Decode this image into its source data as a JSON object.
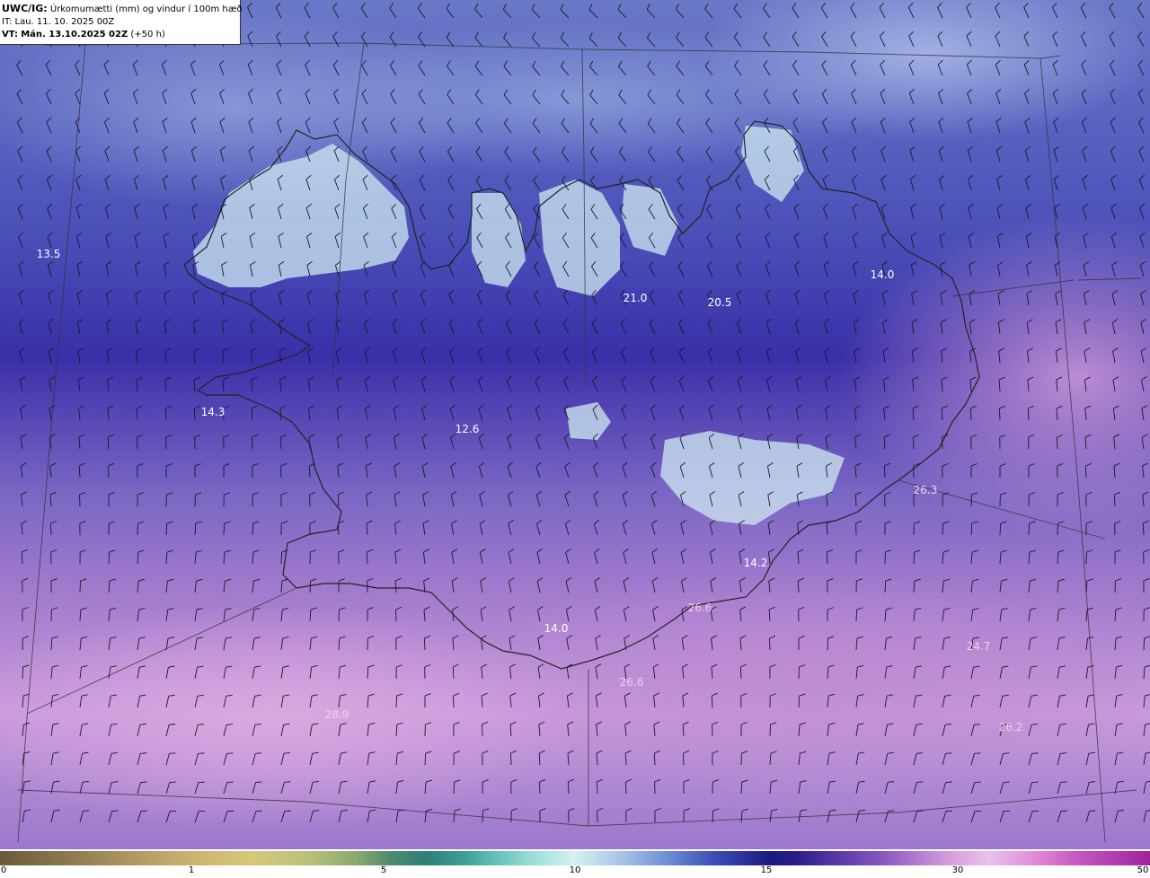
{
  "header": {
    "code": "UWC/IG:",
    "subtitle": "Úrkomumætti (mm) og vindur í 100m hæð",
    "it_line": "IT: Lau. 11. 10. 2025 00Z",
    "vt_label": "VT:",
    "vt_value": "Mán. 13.10.2025 02Z",
    "vt_suffix": "(+50 h)"
  },
  "map": {
    "labels": [
      {
        "id": "nw-sea",
        "text": "13.5"
      },
      {
        "id": "west",
        "text": "14.3"
      },
      {
        "id": "central-w",
        "text": "12.6"
      },
      {
        "id": "north",
        "text": "21.0"
      },
      {
        "id": "north-e",
        "text": "20.5"
      },
      {
        "id": "east",
        "text": "14.0"
      },
      {
        "id": "se-land",
        "text": "14.2"
      },
      {
        "id": "south",
        "text": "14.0"
      },
      {
        "id": "east-sea",
        "text": "26.3"
      },
      {
        "id": "se-coast",
        "text": "26.6"
      },
      {
        "id": "se-sea",
        "text": "24.7"
      },
      {
        "id": "s-sea",
        "text": "26.6"
      },
      {
        "id": "sw-sea",
        "text": "28.9"
      },
      {
        "id": "sse-sea",
        "text": "26.2"
      }
    ],
    "colors": {
      "precip_low": "#d4f1f0",
      "precip_mid": "#1b1a80",
      "precip_high": "#c79adb",
      "coastline": "#222222",
      "grid": "#333333"
    }
  },
  "colorbar": {
    "ticks": [
      "0",
      "1",
      "5",
      "10",
      "15",
      "30",
      "50"
    ]
  }
}
